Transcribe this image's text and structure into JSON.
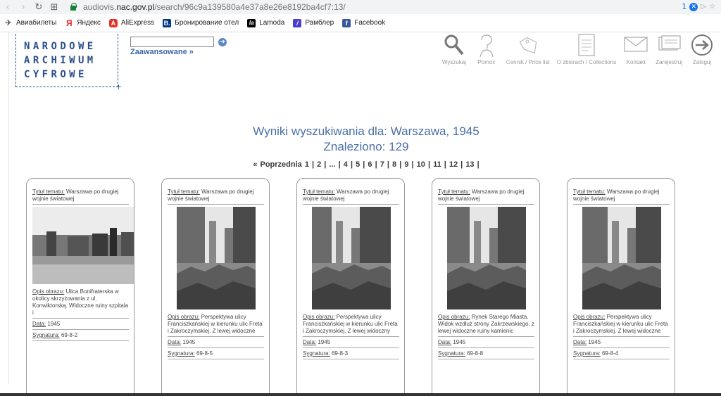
{
  "browser": {
    "url_prefix": "audiovis.",
    "url_host": "nac.gov.pl",
    "url_path": "/search/96c9a139580a4e37a8e26e8192ba4cf7:13/",
    "ext_count": "1"
  },
  "bookmarks": [
    {
      "label": "Авиабилеты",
      "icon": "plane-icon",
      "glyph": "✈"
    },
    {
      "label": "Яндекс",
      "icon": "yandex-icon",
      "glyph": "Я"
    },
    {
      "label": "AliExpress",
      "icon": "aliexpress-icon",
      "glyph": "A"
    },
    {
      "label": "Бронирование отел",
      "icon": "booking-icon",
      "glyph": "B."
    },
    {
      "label": "Lamoda",
      "icon": "lamoda-icon",
      "glyph": "la"
    },
    {
      "label": "Рамблер",
      "icon": "rambler-icon",
      "glyph": "/"
    },
    {
      "label": "Facebook",
      "icon": "facebook-icon",
      "glyph": "f"
    }
  ],
  "logo": {
    "line1": "NARODOWE",
    "line2": "ARCHIWUM",
    "line3": "CYFROWE"
  },
  "search": {
    "advanced_label": "Zaawansowane »",
    "go_glyph": "➔"
  },
  "topnav": [
    {
      "label": "Wyszukaj",
      "icon": "magnifier-icon"
    },
    {
      "label": "Pomoc",
      "icon": "help-icon"
    },
    {
      "label": "Cennik / Price list",
      "icon": "price-tag-icon"
    },
    {
      "label": "O zbiorach / Collections",
      "icon": "document-icon"
    },
    {
      "label": "Kontakt",
      "icon": "envelope-icon"
    },
    {
      "label": "Zarejestruj",
      "icon": "register-icon"
    },
    {
      "label": "Zaloguj",
      "icon": "login-arrow-icon"
    }
  ],
  "results": {
    "heading": "Wyniki wyszukiwania dla: Warszawa, 1945",
    "found": "Znaleziono: 129",
    "pager": "« Poprzednia  1 | 2 | ... | 4 | 5 | 6 | 7 | 8 | 9 | 10 | 11 | 12 | 13 |"
  },
  "labels": {
    "topic": "Tytuł tematu:",
    "desc": "Opis obrazu:",
    "date": "Data:",
    "sig": "Sygnatura:"
  },
  "cards": [
    {
      "topic": "Warszawa po drugiej wojnie światowej",
      "desc": "Ulica Bonifraterska w okolicy skrzyżowania z ul. Konwiktorską. Widoczne ruiny szpitala i",
      "date": "1945",
      "sig": "69-8-2"
    },
    {
      "topic": "Warszawa po drugiej wojnie światowej",
      "desc": "Perspektywa ulicy Franciszkańskiej w kierunku ulic Freta i Zakroczymskiej. Z lewej widoczne",
      "date": "1945",
      "sig": "69-8-5"
    },
    {
      "topic": "Warszawa po drugiej wojnie światowej",
      "desc": "Perspektywa ulicy Franciszkańskiej w kierunku ulic Freta i Zakroczymskiej. Z lewej widoczny",
      "date": "1945",
      "sig": "69-8-3"
    },
    {
      "topic": "Warszawa po drugiej wojnie światowej",
      "desc": "Rynek Starego Miasta. Widok wzdłuż strony Zakrzewskiego, z lewej widoczne ruiny kamienic",
      "date": "1945",
      "sig": "69-8-8"
    },
    {
      "topic": "Warszawa po drugiej wojnie światowej",
      "desc": "Perspektywa ulicy Franciszkańskiej w kierunku ulic Freta i Zakroczymskiej. Z lewej widoczne",
      "date": "1945",
      "sig": "69-8-4"
    }
  ]
}
